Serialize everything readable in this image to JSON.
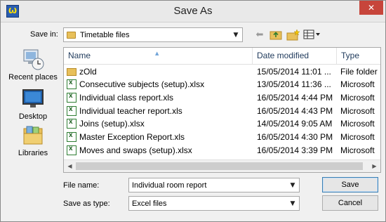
{
  "window": {
    "title": "Save As",
    "close_glyph": "✕",
    "app_icon": "Ѡ"
  },
  "save_in": {
    "label": "Save in:",
    "value": "Timetable files"
  },
  "toolbar": {
    "back_glyph": "⬅",
    "up_glyph": "↥",
    "new_folder_glyph": "✚",
    "views_glyph": "▦▾"
  },
  "places": [
    {
      "label": "Recent places"
    },
    {
      "label": "Desktop"
    },
    {
      "label": "Libraries"
    }
  ],
  "columns": {
    "name": "Name",
    "date": "Date modified",
    "type": "Type"
  },
  "files": [
    {
      "name": "zOld",
      "date": "15/05/2014 11:01 ...",
      "type": "File folder",
      "kind": "folder"
    },
    {
      "name": "Consecutive subjects (setup).xlsx",
      "date": "13/05/2014 11:36 ...",
      "type": "Microsoft",
      "kind": "excel"
    },
    {
      "name": "Individual class report.xls",
      "date": "16/05/2014 4:44 PM",
      "type": "Microsoft",
      "kind": "excel"
    },
    {
      "name": "Individual teacher report.xls",
      "date": "16/05/2014 4:43 PM",
      "type": "Microsoft",
      "kind": "excel"
    },
    {
      "name": "Joins (setup).xlsx",
      "date": "14/05/2014 9:05 AM",
      "type": "Microsoft",
      "kind": "excel"
    },
    {
      "name": "Master Exception Report.xls",
      "date": "16/05/2014 4:30 PM",
      "type": "Microsoft",
      "kind": "excel"
    },
    {
      "name": "Moves and swaps (setup).xlsx",
      "date": "16/05/2014 3:39 PM",
      "type": "Microsoft",
      "kind": "excel"
    }
  ],
  "file_name": {
    "label": "File name:",
    "value": "Individual room report"
  },
  "save_as_type": {
    "label": "Save as type:",
    "value": "Excel files"
  },
  "buttons": {
    "save": "Save",
    "cancel": "Cancel"
  },
  "dropdown_glyph": "▼"
}
